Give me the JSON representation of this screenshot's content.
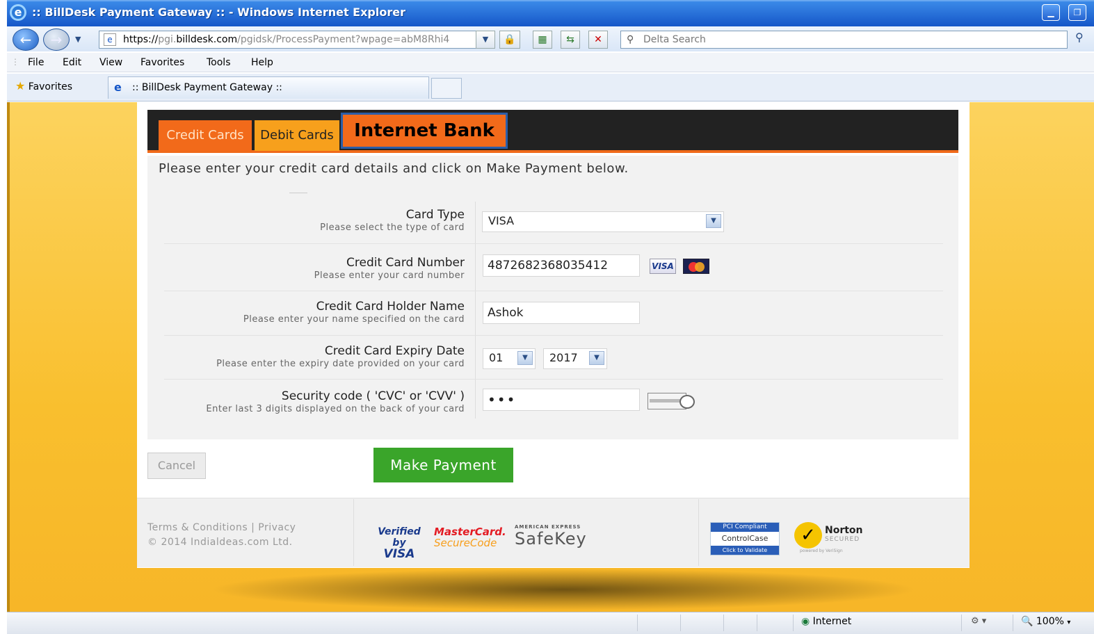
{
  "window": {
    "title": ":: BillDesk Payment Gateway :: - Windows Internet Explorer",
    "ie_icon": "e"
  },
  "address": {
    "prefix": "https://",
    "host_pre": "pgi.",
    "host": "billdesk.com",
    "path": "/pgidsk/ProcessPayment?wpage=abM8Rhi4",
    "search_placeholder": "Delta Search"
  },
  "menu": [
    "File",
    "Edit",
    "View",
    "Favorites",
    "Tools",
    "Help"
  ],
  "favorites_label": "Favorites",
  "tab_title": ":: BillDesk Payment Gateway ::",
  "payment_tabs": {
    "credit": "Credit Cards",
    "debit": "Debit Cards",
    "netbank": "Internet Bank"
  },
  "instructions": "Please enter your credit card details and click on Make Payment below.",
  "form": {
    "card_type": {
      "label": "Card Type",
      "hint": "Please select the type of card",
      "value": "VISA"
    },
    "card_number": {
      "label": "Credit Card Number",
      "hint": "Please enter your card number",
      "value": "4872682368035412"
    },
    "holder_name": {
      "label": "Credit Card Holder Name",
      "hint": "Please enter your name specified on the card",
      "value": "Ashok"
    },
    "expiry": {
      "label": "Credit Card Expiry Date",
      "hint": "Please enter the expiry date provided on your card",
      "month": "01",
      "year": "2017"
    },
    "cvv": {
      "label": "Security code ( 'CVC' or 'CVV' )",
      "hint": "Enter last 3 digits displayed on the back of your card",
      "value": "•••"
    }
  },
  "buttons": {
    "cancel": "Cancel",
    "pay": "Make Payment"
  },
  "footer": {
    "links": "Terms & Conditions | Privacy",
    "copyright": "© 2014 Indialdeas.com Ltd.",
    "verified_by": "Verified by",
    "visa": "VISA",
    "mastercard": "MasterCard.",
    "securecode": "SecureCode",
    "amex": "AMERICAN EXPRESS",
    "safekey": "SafeKey",
    "pci": "PCI Compliant",
    "controlcase": "ControlCase",
    "click_validate": "Click to Validate",
    "norton": "Norton",
    "secured": "SECURED",
    "verisign": "powered by VeriSign"
  },
  "status": {
    "zone": "Internet",
    "zoom": "100%"
  }
}
